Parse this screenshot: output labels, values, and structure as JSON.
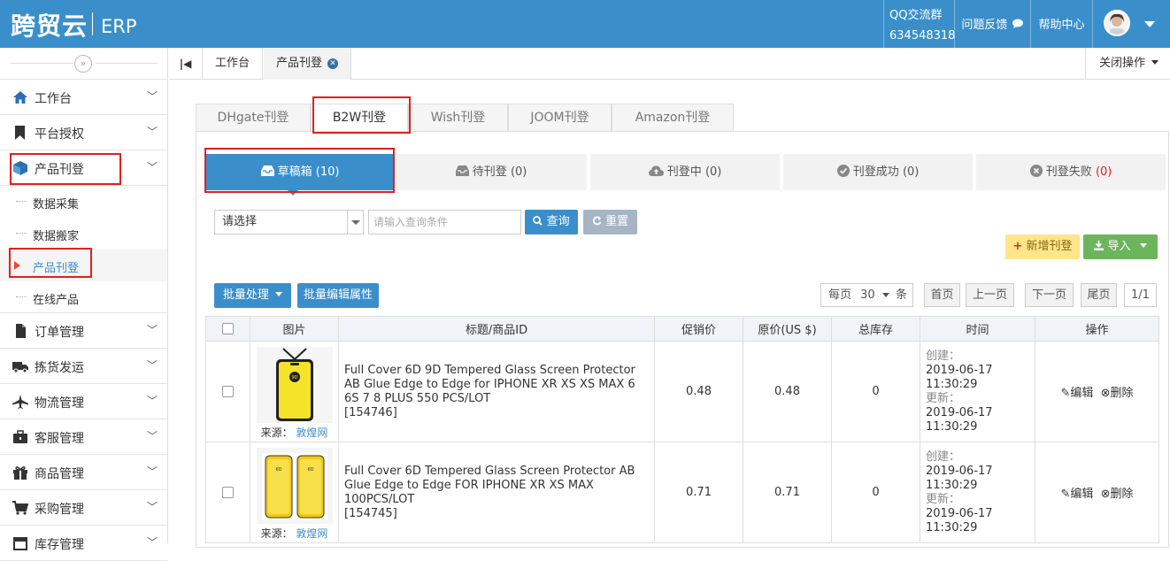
{
  "header": {
    "logo": "跨贸云",
    "logo_suffix": "ERP",
    "qq_group_label": "QQ交流群",
    "qq_group_number": "634548318",
    "feedback": "问题反馈",
    "help": "帮助中心"
  },
  "sidebar": {
    "items": [
      {
        "label": "工作台",
        "icon": "home-icon"
      },
      {
        "label": "平台授权",
        "icon": "bookmark-icon"
      },
      {
        "label": "产品刊登",
        "icon": "cube-icon"
      },
      {
        "label": "订单管理",
        "icon": "file-icon"
      },
      {
        "label": "拣货发运",
        "icon": "truck-icon"
      },
      {
        "label": "物流管理",
        "icon": "plane-icon"
      },
      {
        "label": "客服管理",
        "icon": "briefcase-icon"
      },
      {
        "label": "商品管理",
        "icon": "gift-icon"
      },
      {
        "label": "采购管理",
        "icon": "cart-icon"
      },
      {
        "label": "库存管理",
        "icon": "box-icon"
      }
    ],
    "sub_items": [
      {
        "label": "数据采集"
      },
      {
        "label": "数据搬家"
      },
      {
        "label": "产品刊登"
      },
      {
        "label": "在线产品"
      }
    ]
  },
  "tabbar": {
    "tabs": [
      {
        "label": "工作台"
      },
      {
        "label": "产品刊登"
      }
    ],
    "close_ops": "关闭操作"
  },
  "platform_tabs": [
    {
      "label": "DHgate刊登"
    },
    {
      "label": "B2W刊登"
    },
    {
      "label": "Wish刊登"
    },
    {
      "label": "JOOM刊登"
    },
    {
      "label": "Amazon刊登"
    }
  ],
  "status_tabs": [
    {
      "label": "草稿箱",
      "count": "(10)",
      "icon": "inbox-icon"
    },
    {
      "label": "待刊登",
      "count": "(0)",
      "icon": "inbox-icon"
    },
    {
      "label": "刊登中",
      "count": "(0)",
      "icon": "cloud-upload-icon"
    },
    {
      "label": "刊登成功",
      "count": "(0)",
      "icon": "check-circle-icon"
    },
    {
      "label": "刊登失败",
      "count": "(0)",
      "icon": "x-circle-icon",
      "count_color": "#e02020"
    }
  ],
  "search": {
    "select_value": "请选择",
    "placeholder": "请输入查询条件",
    "query_btn": "查询",
    "reset_btn": "重置"
  },
  "actions": {
    "add": "新增刊登",
    "import": "导入",
    "batch": "批量处理",
    "batch_edit": "批量编辑属性"
  },
  "pagination": {
    "per_page_label": "每页",
    "per_page_value": "30",
    "unit": "条",
    "first": "首页",
    "prev": "上一页",
    "next": "下一页",
    "last": "尾页",
    "page": "1/1"
  },
  "table": {
    "headers": [
      "图片",
      "标题/商品ID",
      "促销价",
      "原价(US $)",
      "总库存",
      "时间",
      "操作"
    ],
    "rows": [
      {
        "source_label": "来源：",
        "source": "敦煌网",
        "title": "Full Cover 6D 9D Tempered Glass Screen Protector AB Glue Edge to Edge for IPHONE XR XS XS MAX 6 6S 7 8 PLUS 550 PCS/LOT",
        "id": "[154746]",
        "promo_price": "0.48",
        "orig_price": "0.48",
        "stock": "0",
        "created_label": "创建：",
        "created": "2019-06-17 11:30:29",
        "updated_label": "更新：",
        "updated": "2019-06-17 11:30:29",
        "edit": "编辑",
        "delete": "删除"
      },
      {
        "source_label": "来源：",
        "source": "敦煌网",
        "title": "Full Cover 6D Tempered Glass Screen Protector AB Glue Edge to Edge FOR IPHONE XR XS MAX 100PCS/LOT",
        "id": "[154745]",
        "promo_price": "0.71",
        "orig_price": "0.71",
        "stock": "0",
        "created_label": "创建：",
        "created": "2019-06-17 11:30:29",
        "updated_label": "更新：",
        "updated": "2019-06-17 11:30:29",
        "edit": "编辑",
        "delete": "删除"
      }
    ]
  },
  "colors": {
    "brand": "#3a8fcb",
    "highlight": "#e02020"
  }
}
